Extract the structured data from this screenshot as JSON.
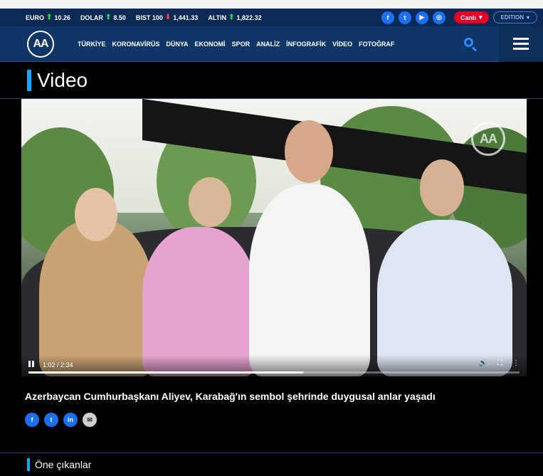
{
  "ticker": [
    {
      "name": "EURO",
      "dir": "up",
      "value": "10.26"
    },
    {
      "name": "DOLAR",
      "dir": "up",
      "value": "8.50"
    },
    {
      "name": "BIST 100",
      "dir": "down",
      "value": "1,441.33"
    },
    {
      "name": "ALTIN",
      "dir": "up",
      "value": "1,822.32"
    }
  ],
  "social": [
    "f",
    "t",
    "▶",
    "◎"
  ],
  "live_label": "Canlı",
  "edition_label": "EDITION",
  "logo_text": "AA",
  "nav": [
    "TÜRKİYE",
    "KORONAVİRÜS",
    "DÜNYA",
    "EKONOMİ",
    "SPOR",
    "ANALİZ",
    "İNFOGRAFİK",
    "VİDEO",
    "FOTOĞRAF"
  ],
  "page_title": "Video",
  "video": {
    "watermark": "AA",
    "time": "1:02 / 2:34",
    "progress": 0.56
  },
  "caption": "Azerbaycan Cumhurbaşkanı Aliyev, Karabağ'ın sembol şehrinde duygusal anlar yaşadı",
  "share": [
    "f",
    "t",
    "in",
    "✉"
  ],
  "highlights_title": "Öne çıkanlar",
  "colors": {
    "accent": "#19a6ff",
    "nav_bg": "#103667",
    "live": "#e60023"
  }
}
